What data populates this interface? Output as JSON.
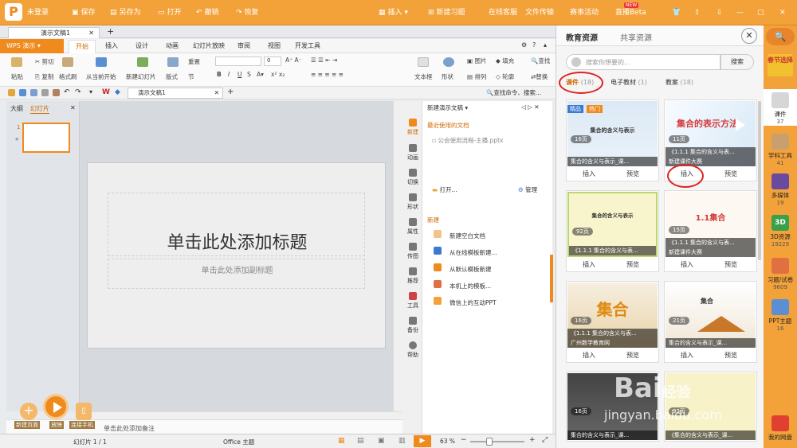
{
  "topbar": {
    "account": "未登录",
    "save": "保存",
    "save_as": "另存为",
    "open": "打开",
    "undo": "撤销",
    "redo": "恢复",
    "insert": "插入",
    "new_exercise": "新建习题",
    "online_service": "在线客服",
    "file_transfer": "文件传输",
    "contest": "赛事活动",
    "live": "直播Beta",
    "new_badge": "NEW"
  },
  "tabs": {
    "doc_tab": "演示文稿1",
    "add": "+"
  },
  "ribbon_tabs": [
    "开始",
    "插入",
    "设计",
    "动画",
    "幻灯片放映",
    "审阅",
    "视图",
    "开发工具"
  ],
  "wps_menu": "WPS 演示",
  "ribbon": {
    "paste": "粘贴",
    "cut": "剪切",
    "copy": "复制",
    "format_painter": "格式刷",
    "from_current": "从当前开始",
    "new_slide": "新建幻灯片",
    "layout": "版式",
    "reset": "重置",
    "section": "节",
    "font_size": "0",
    "textbox": "文本框",
    "shape": "形状",
    "picture": "图片",
    "fill": "填充",
    "arrange": "排列",
    "outline": "轮廓",
    "find": "查找",
    "replace": "替换"
  },
  "quickbar": {
    "doc_tab": "演示文稿1",
    "search": "查找命令、搜索..."
  },
  "left_panel": {
    "tab_outline": "大纲",
    "tab_slides": "幻灯片",
    "slide_num": "1",
    "star": "★"
  },
  "slide": {
    "title": "单击此处添加标题",
    "subtitle": "单击此处添加副标题"
  },
  "notes": "单击此处添加备注",
  "task_icons": [
    "新建",
    "动画",
    "切换",
    "形状",
    "属性",
    "传图",
    "推荐",
    "工具",
    "备份",
    "帮助"
  ],
  "taskpane": {
    "title": "新建演示文稿",
    "recent": "最近使用的文档",
    "recent_file": "公会使用流程-主播.pptx",
    "open": "打开...",
    "manage": "管理",
    "new_header": "新建",
    "items": [
      "新建空白文档",
      "从在线模板新建...",
      "从默认模板新建",
      "本机上的模板...",
      "微信上的互动PPT"
    ]
  },
  "bottom_tools": {
    "new_page": "新建页面",
    "play": "放映",
    "connect": "连接手机"
  },
  "statusbar": {
    "slide_count": "幻灯片 1 / 1",
    "theme": "Office 主题",
    "zoom": "63 %"
  },
  "edu": {
    "tab_edu": "教育资源",
    "tab_share": "共享资源",
    "search_placeholder": "搜索你想要的...",
    "search_btn": "搜索",
    "filters": [
      {
        "label": "课件",
        "count": "(18)"
      },
      {
        "label": "电子教材",
        "count": "(1)"
      },
      {
        "label": "教案",
        "count": "(18)"
      }
    ],
    "insert": "插入",
    "preview": "预览",
    "cards": [
      {
        "title": "集合的含义与表示_课...",
        "pages": "16页",
        "badge1": "精品",
        "badge2": "热门",
        "img_text": "集合的含义与表示",
        "sub": ""
      },
      {
        "title": "《1.1.1 集合的含义与表...",
        "pages": "11页",
        "badge1": "",
        "badge2": "",
        "img_text": "集合的表示方法",
        "sub": "新建课件大赛"
      },
      {
        "title": "《1.1.1 集合的含义与表...",
        "pages": "92页",
        "badge1": "",
        "badge2": "",
        "img_text": "集合的含义与表示",
        "sub": ""
      },
      {
        "title": "《1.1.1 集合的含义与表...",
        "pages": "15页",
        "badge1": "",
        "badge2": "",
        "img_text": "1.1集合",
        "sub": "新建课件大赛"
      },
      {
        "title": "《1.1.1 集合的含义与表...",
        "pages": "16页",
        "badge1": "",
        "badge2": "",
        "img_text": "集合",
        "sub": "广州数学教育网"
      },
      {
        "title": "集合的含义与表示_课...",
        "pages": "21页",
        "badge1": "",
        "badge2": "",
        "img_text": "集合",
        "sub": ""
      },
      {
        "title": "集合的含义与表示_课...",
        "pages": "16页",
        "badge1": "",
        "badge2": "",
        "img_text": "",
        "sub": ""
      },
      {
        "title": "《集合的含义与表示_课...",
        "pages": "93页",
        "badge1": "",
        "badge2": "",
        "img_text": "",
        "sub": ""
      }
    ]
  },
  "rightbar": {
    "exam": "春节选择",
    "tools": [
      {
        "label": "课件",
        "count": "37"
      },
      {
        "label": "学科工具",
        "count": "41"
      },
      {
        "label": "多媒体",
        "count": "19"
      },
      {
        "label": "3D资源",
        "count": "19229"
      },
      {
        "label": "习题/试卷",
        "count": "9609"
      },
      {
        "label": "PPT主题",
        "count": "16"
      }
    ],
    "my_space": "我的网盘"
  },
  "watermark": {
    "text": "Bai",
    "site": "jingyan.baidu.com",
    "jy": "经验"
  },
  "colors": {
    "accent": "#f3a23a",
    "brand_orange": "#f08a1c",
    "highlight_red": "#e02020"
  }
}
